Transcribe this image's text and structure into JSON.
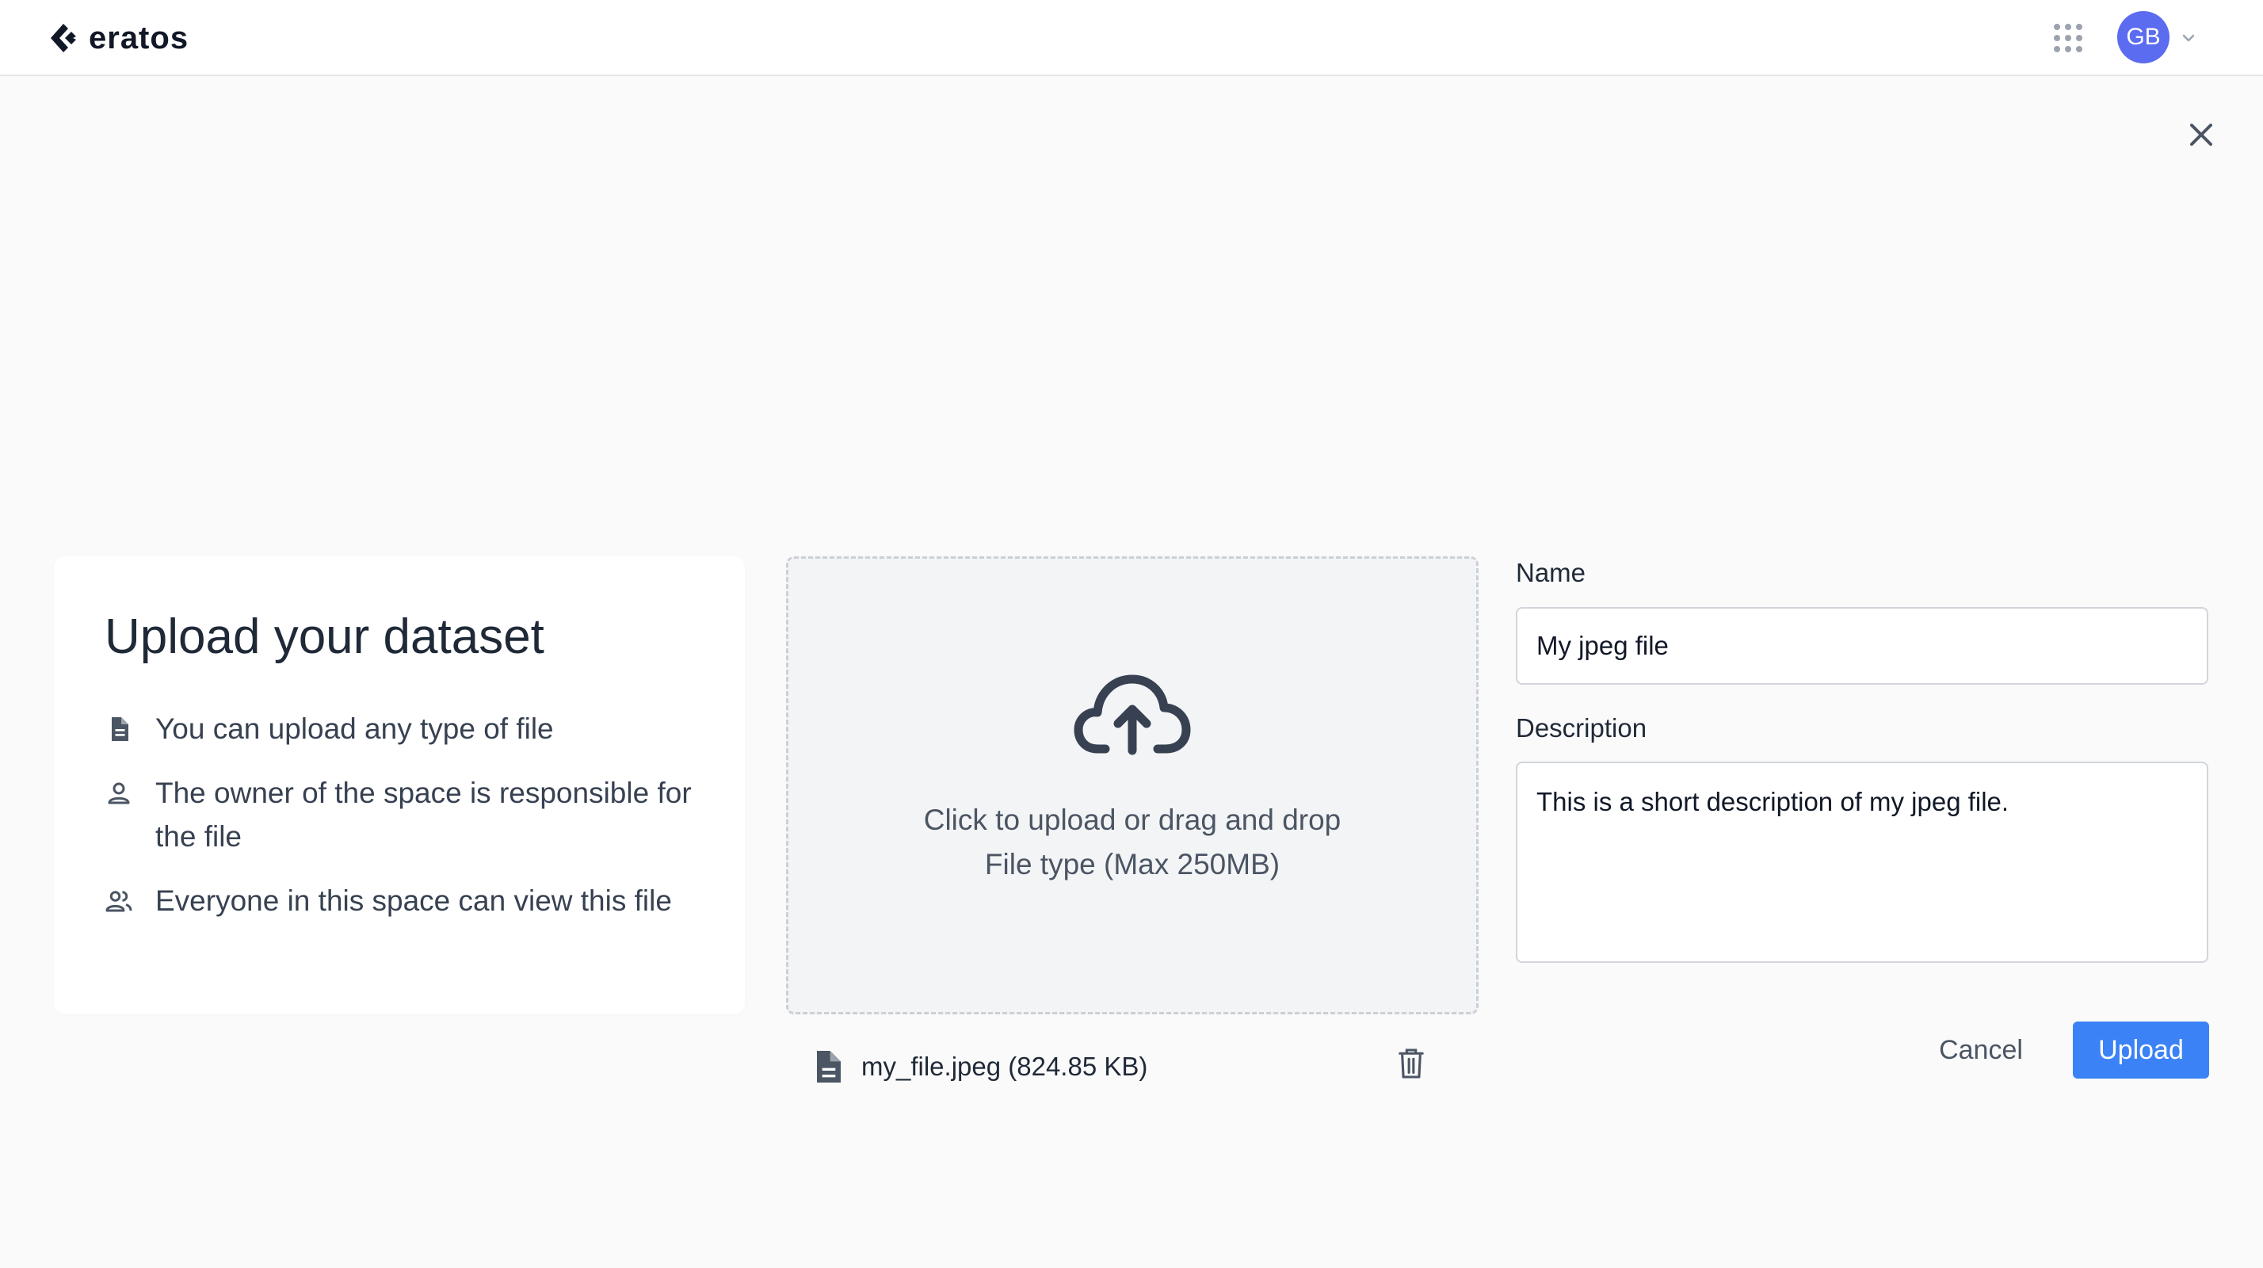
{
  "header": {
    "brand": "eratos",
    "avatar_initials": "GB",
    "apps_icon": "apps-grid-icon",
    "chevron_icon": "chevron-down-icon"
  },
  "modal": {
    "close_icon": "close-icon"
  },
  "info": {
    "title": "Upload your dataset",
    "items": [
      {
        "icon": "document-icon",
        "text": "You can upload any type of file"
      },
      {
        "icon": "person-icon",
        "text": "The owner of the space is responsible for the file"
      },
      {
        "icon": "people-icon",
        "text": "Everyone in this space can view this file"
      }
    ]
  },
  "dropzone": {
    "icon": "cloud-upload-icon",
    "line1": "Click to upload or drag and drop",
    "line2": "File type (Max 250MB)"
  },
  "file": {
    "icon": "document-icon",
    "label": "my_file.jpeg (824.85 KB)",
    "delete_icon": "trash-icon"
  },
  "form": {
    "name_label": "Name",
    "name_value": "My jpeg file",
    "description_label": "Description",
    "description_value": "This is a short description of my jpeg file.",
    "cancel_label": "Cancel",
    "upload_label": "Upload"
  },
  "colors": {
    "accent": "#3b82f6",
    "avatar": "#5b6cf0",
    "background": "#fafafa"
  }
}
